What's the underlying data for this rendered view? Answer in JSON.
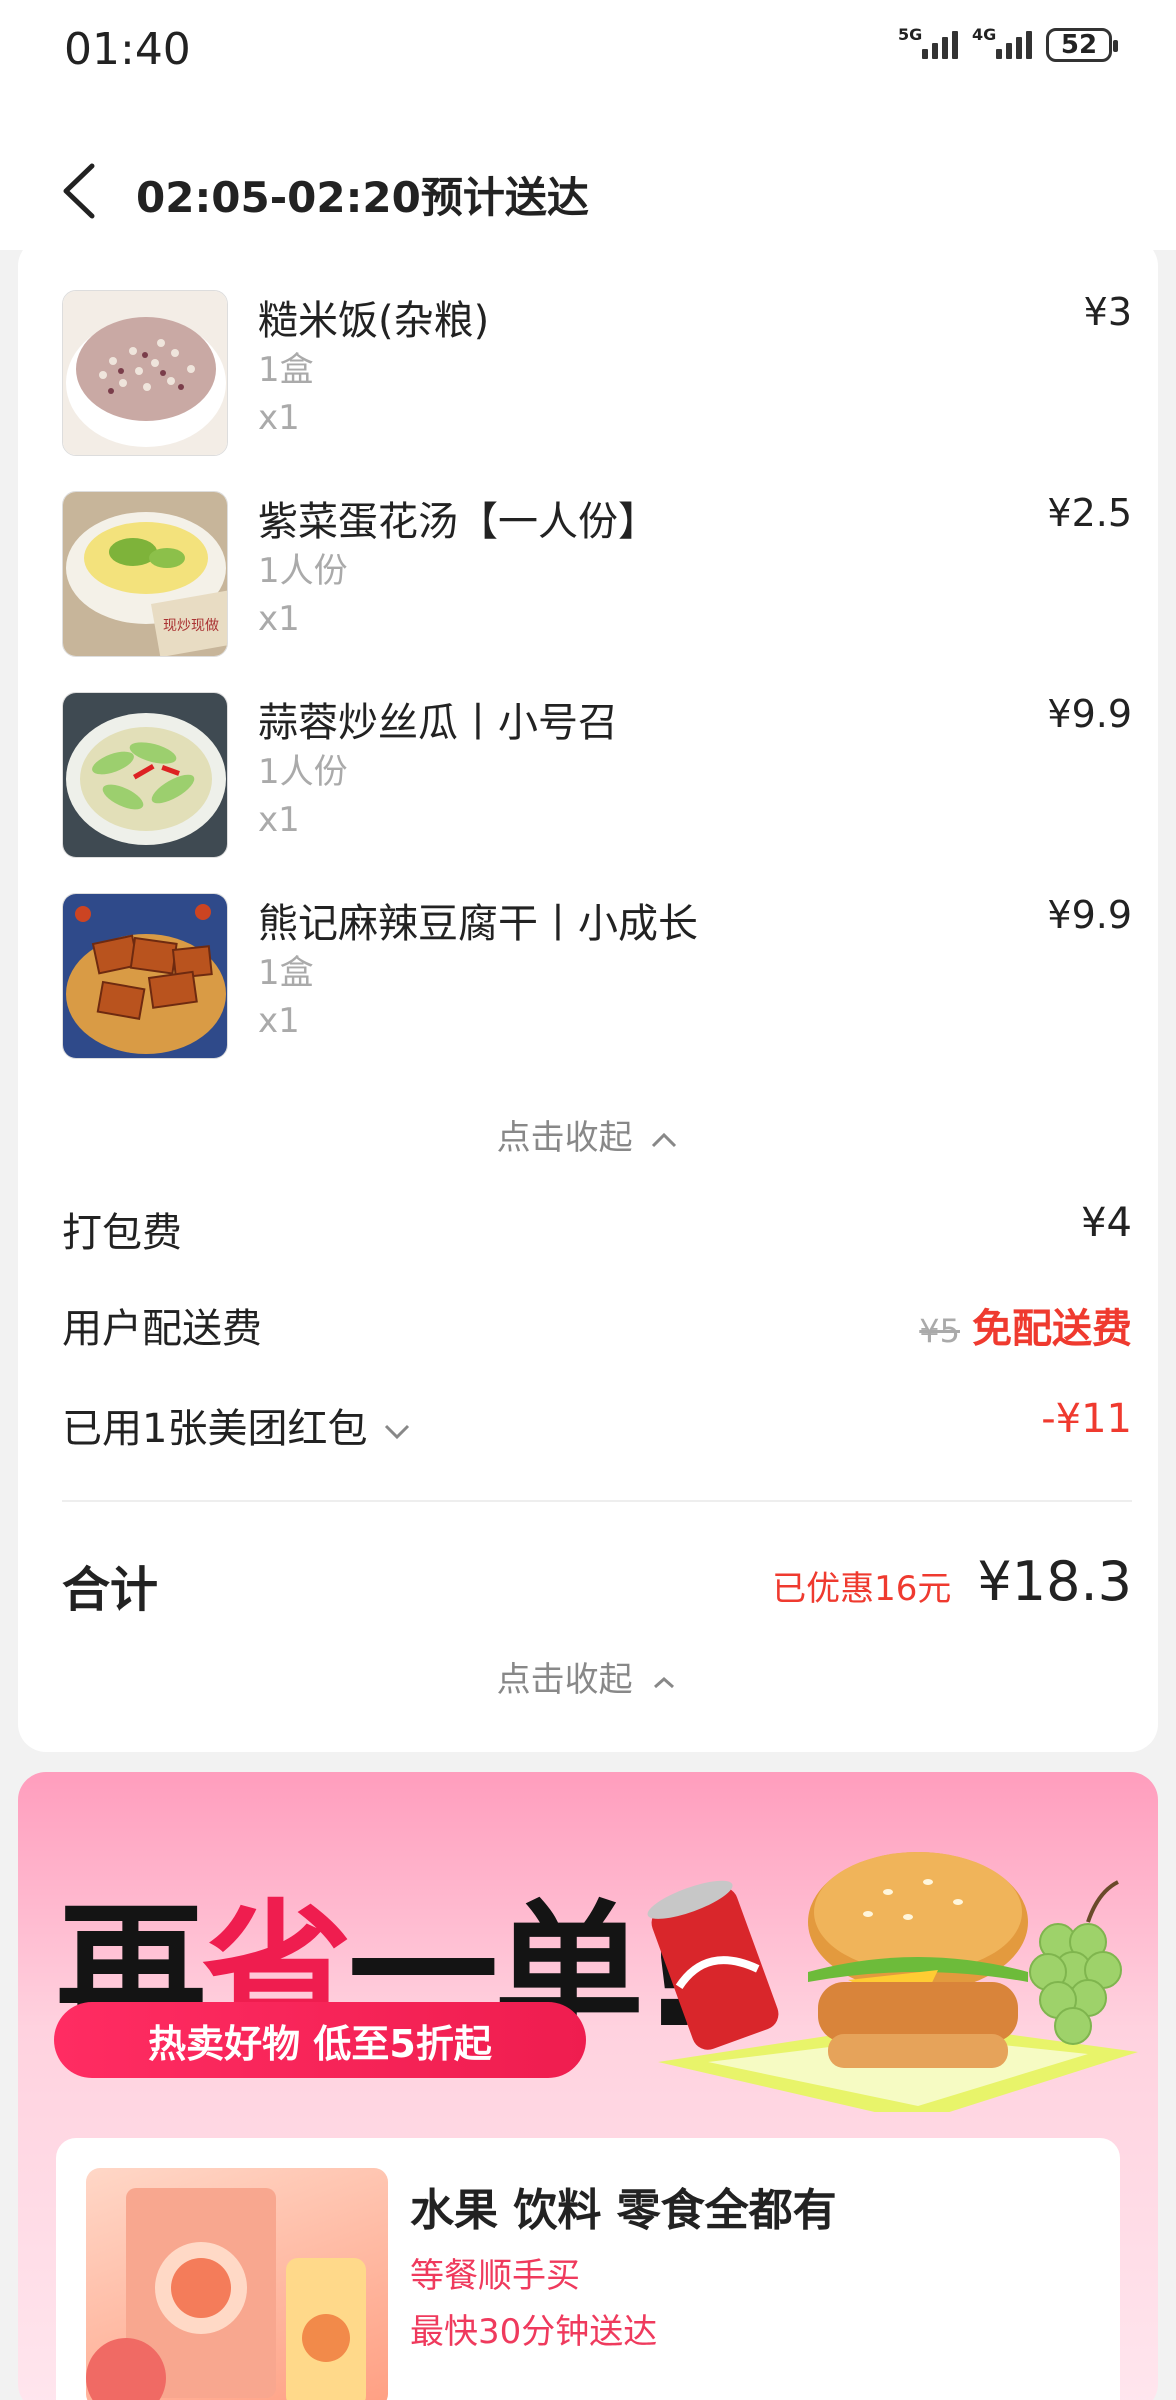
{
  "status": {
    "time": "01:40",
    "battery": "52",
    "net1": "5G",
    "net2": "4G"
  },
  "nav": {
    "title": "02:05-02:20预计送达"
  },
  "items": [
    {
      "name": "糙米饭(杂粮)",
      "spec": "1盒",
      "qty": "x1",
      "price": "¥3"
    },
    {
      "name": "紫菜蛋花汤【一人份】",
      "spec": "1人份",
      "qty": "x1",
      "price": "¥2.5"
    },
    {
      "name": "蒜蓉炒丝瓜丨小号召",
      "spec": "1人份",
      "qty": "x1",
      "price": "¥9.9"
    },
    {
      "name": "熊记麻辣豆腐干丨小成长",
      "spec": "1盒",
      "qty": "x1",
      "price": "¥9.9"
    }
  ],
  "collapse_label": "点击收起",
  "fees": {
    "packing_label": "打包费",
    "packing_value": "¥4",
    "delivery_label": "用户配送费",
    "delivery_original": "¥5",
    "delivery_value": "免配送费",
    "coupon_label": "已用1张美团红包",
    "coupon_value": "-¥11"
  },
  "total": {
    "label": "合计",
    "discount": "已优惠16元",
    "amount": "¥18.3"
  },
  "promo": {
    "title_part1": "再",
    "title_part2": "省",
    "title_part3": "一单!",
    "pill": "热卖好物 低至5折起",
    "card_title": "水果 饮料 零食全都有",
    "card_sub1": "等餐顺手买",
    "card_sub2": "最快30分钟送达"
  },
  "colors": {
    "accent_red": "#ef3a2f",
    "promo_red": "#ef1d4f"
  }
}
